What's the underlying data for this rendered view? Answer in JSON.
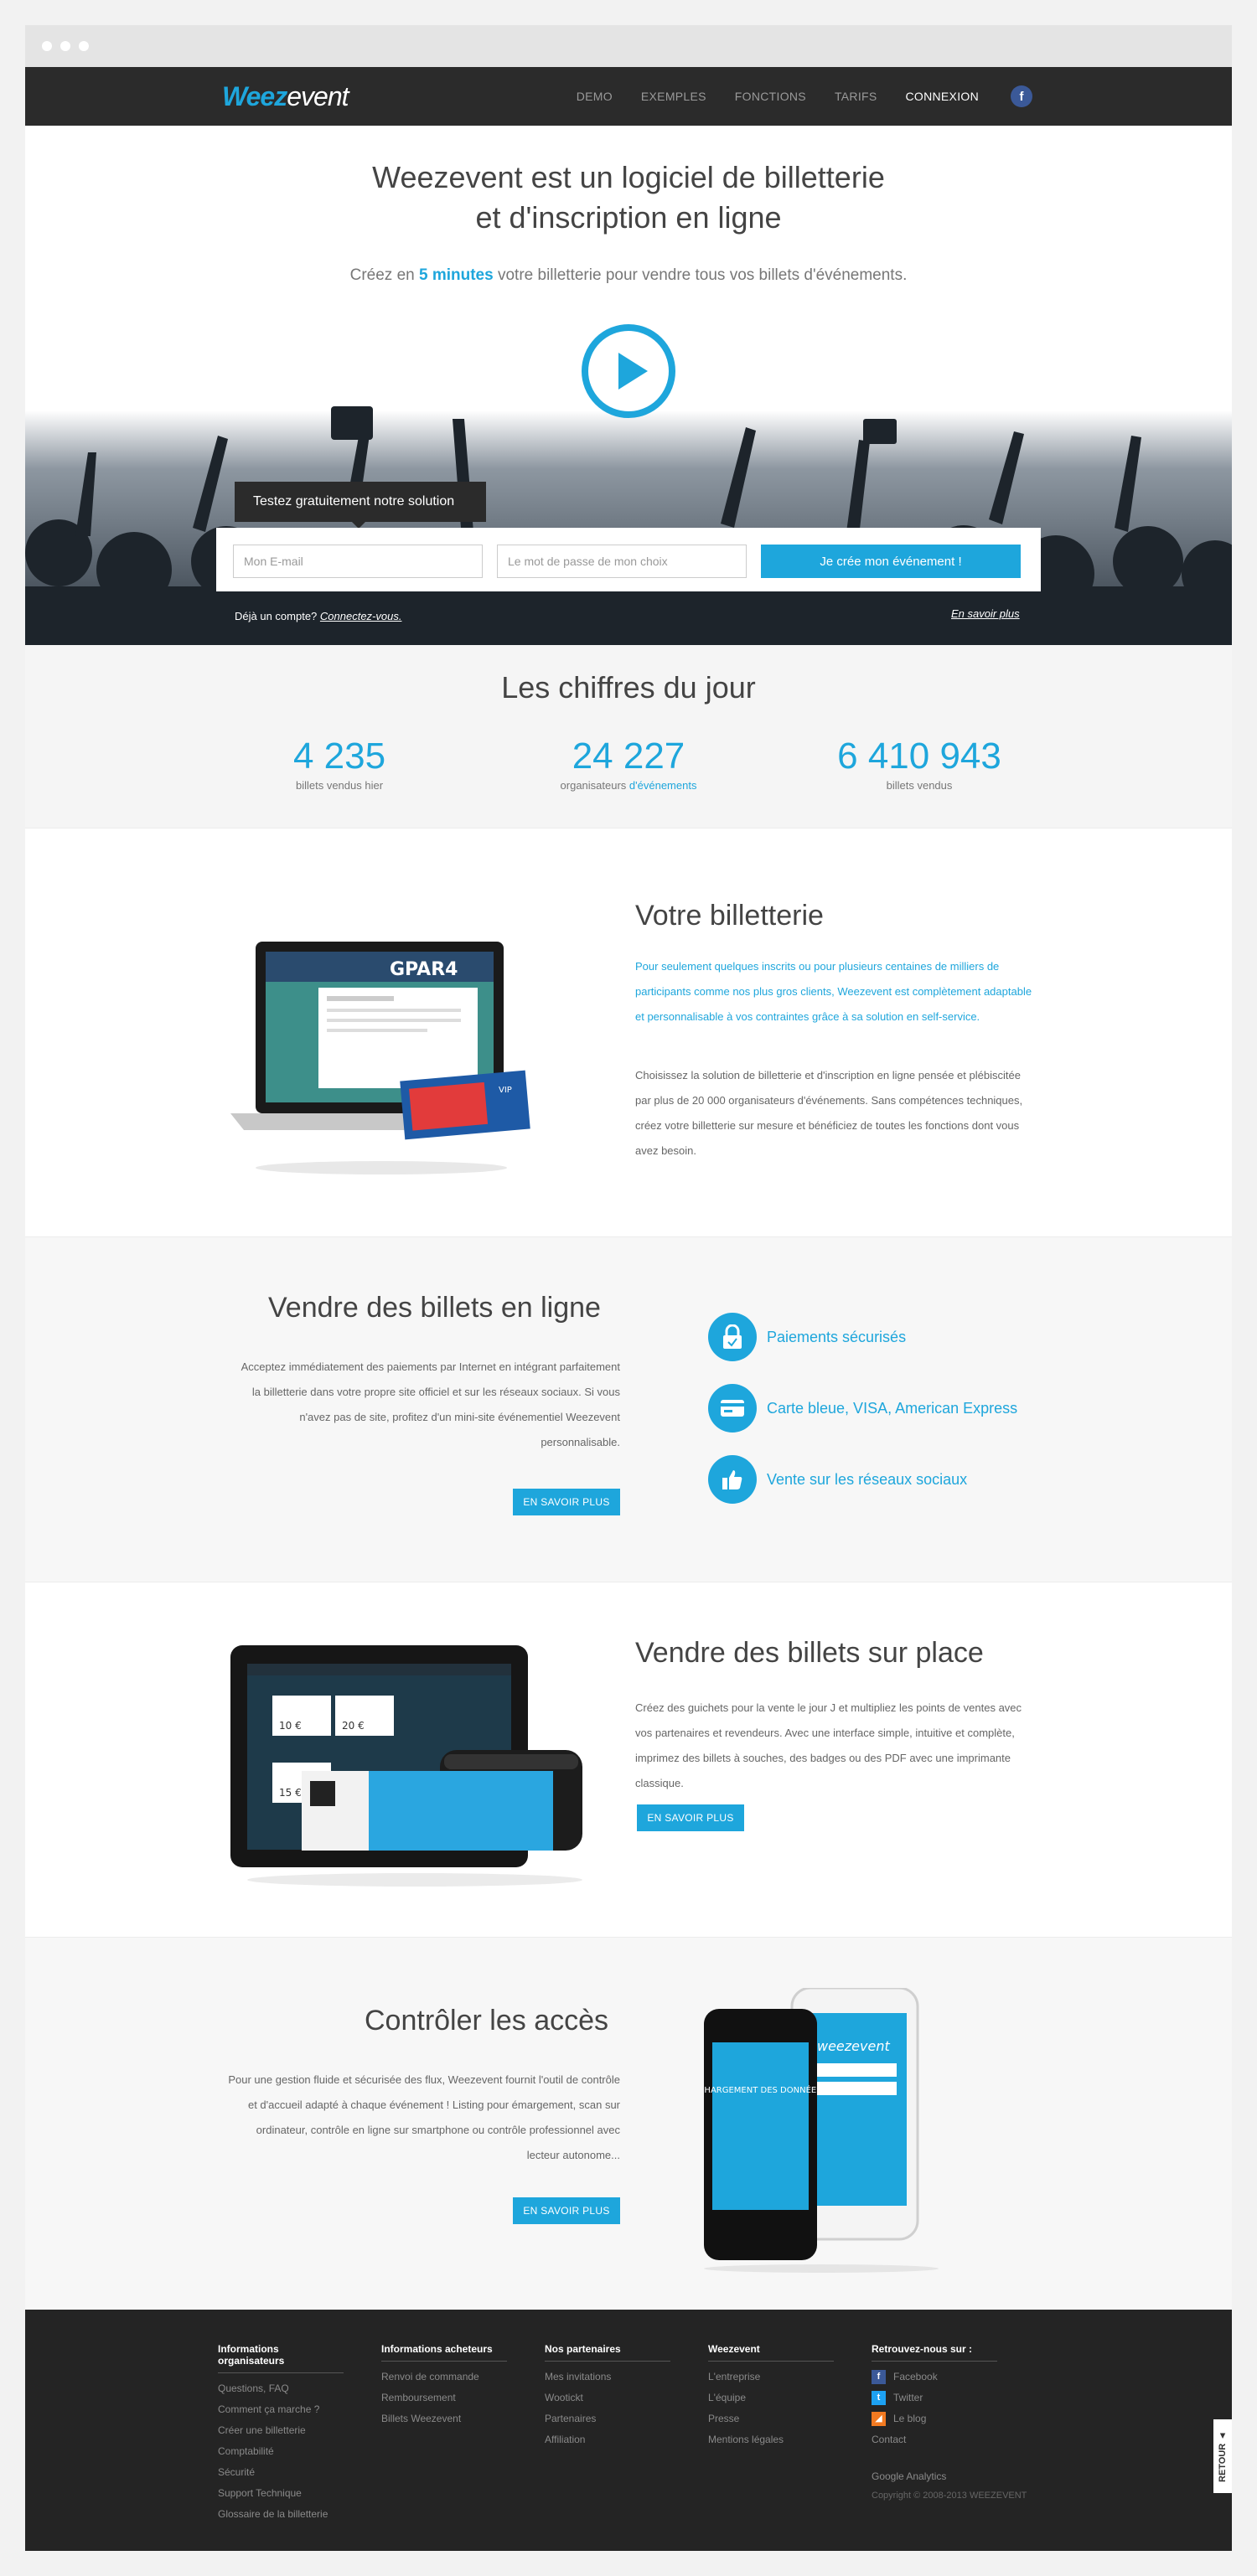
{
  "colors": {
    "accent": "#1ea6dc",
    "dark": "#2b2b2b",
    "facebook": "#3b5998",
    "twitter": "#1da1f2",
    "blog": "#f27a21"
  },
  "brand": {
    "logo_a": "Weez",
    "logo_b": "event"
  },
  "nav": {
    "items": [
      "DEMO",
      "EXEMPLES",
      "FONCTIONS",
      "TARIFS"
    ],
    "login": "CONNEXION",
    "facebook": "f"
  },
  "hero": {
    "title_line1": "Weezevent est un logiciel de billetterie",
    "title_line2": "et d'inscription en ligne",
    "sub_before": "Créez en ",
    "sub_highlight": "5 minutes",
    "sub_after": " votre billetterie pour vendre tous vos billets d'événements.",
    "signup_tab": "Testez gratuitement notre solution",
    "email_placeholder": "Mon E-mail",
    "password_placeholder": "Le mot de passe de mon choix",
    "cta": "Je crée mon événement !",
    "already_text": "Déjà un compte? ",
    "already_link": "Connectez-vous.",
    "learn_more": "En savoir plus"
  },
  "stats": {
    "title": "Les chiffres du jour",
    "items": [
      {
        "value": "4 235",
        "label": "billets vendus hier",
        "label_highlight": ""
      },
      {
        "value": "24 227",
        "label": "organisateurs ",
        "label_highlight": "d'événements"
      },
      {
        "value": "6 410 943",
        "label": "billets vendus",
        "label_highlight": ""
      }
    ]
  },
  "billetterie": {
    "title": "Votre billetterie",
    "lead": "Pour seulement quelques inscrits ou pour plusieurs centaines de milliers de participants comme nos plus gros clients, Weezevent est complètement adaptable et personnalisable à vos contraintes grâce à sa solution en self-service.",
    "body": "Choisissez la solution de billetterie et d'inscription en ligne pensée et plébiscitée par plus de 20 000 organisateurs d'événements. Sans compétences techniques, créez votre billetterie sur mesure et bénéficiez de toutes les fonctions dont vous avez besoin.",
    "screen_text": "GPAR4",
    "ticket_badge": "VIP"
  },
  "online": {
    "title": "Vendre des billets en ligne",
    "body": "Acceptez immédiatement des paiements par Internet en intégrant parfaitement la billetterie dans votre propre site officiel et sur les réseaux sociaux. Si vous n'avez pas de site, profitez d'un mini-site événementiel Weezevent personnalisable.",
    "button": "EN SAVOIR PLUS",
    "features": [
      "Paiements sécurisés",
      "Carte bleue, VISA, American Express",
      "Vente sur les réseaux sociaux"
    ]
  },
  "onsite": {
    "title": "Vendre des billets sur place",
    "body": "Créez des guichets pour la vente le jour J et multipliez les points de ventes avec vos partenaires et revendeurs. Avec une interface simple, intuitive et complète, imprimez des billets à souches, des badges ou des PDF avec une imprimante classique.",
    "button": "EN SAVOIR PLUS",
    "price1": "10 €",
    "price2": "20 €",
    "price3": "15 €"
  },
  "access": {
    "title": "Contrôler les accès",
    "body": "Pour une gestion fluide et sécurisée des flux, Weezevent fournit l'outil de contrôle et d'accueil adapté à chaque événement ! Listing pour émargement, scan sur ordinateur, contrôle en ligne sur smartphone ou contrôle professionnel avec lecteur autonome...",
    "button": "EN SAVOIR PLUS",
    "phone_text": "CHARGEMENT DES DONNÉES"
  },
  "footer": {
    "cols": [
      {
        "title": "Informations organisateurs",
        "links": [
          "Questions, FAQ",
          "Comment ça marche ?",
          "Créer une billetterie",
          "Comptabilité",
          "Sécurité",
          "Support Technique",
          "Glossaire de la billetterie"
        ]
      },
      {
        "title": "Informations acheteurs",
        "links": [
          "Renvoi de commande",
          "Remboursement",
          "Billets Weezevent"
        ]
      },
      {
        "title": "Nos partenaires",
        "links": [
          "Mes invitations",
          "Wootickt",
          "Partenaires",
          "Affiliation"
        ]
      },
      {
        "title": "Weezevent",
        "links": [
          "L'entreprise",
          "L'équipe",
          "Presse",
          "Mentions légales"
        ]
      },
      {
        "title": "Retrouvez-nous sur :",
        "links": [
          "Facebook",
          "Twitter",
          "Le blog",
          "Contact"
        ]
      }
    ],
    "analytics": "Google Analytics",
    "copyright": "Copyright © 2008-2013 WEEZEVENT",
    "back_to_top": "RETOUR ▲"
  }
}
